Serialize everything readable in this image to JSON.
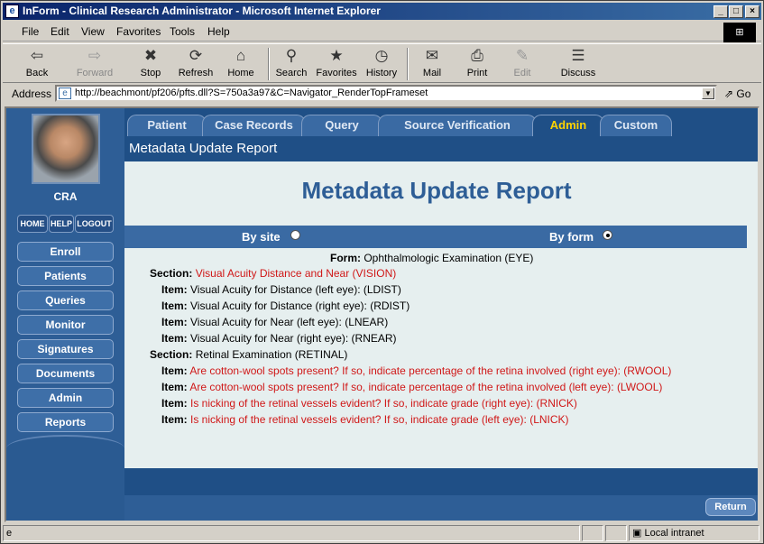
{
  "window": {
    "title": "InForm - Clinical Research Administrator - Microsoft Internet Explorer"
  },
  "menu": [
    "File",
    "Edit",
    "View",
    "Favorites",
    "Tools",
    "Help"
  ],
  "toolbar": [
    {
      "label": "Back",
      "icon": "back-arrow-icon",
      "glyph": "⇦"
    },
    {
      "label": "Forward",
      "icon": "forward-arrow-icon",
      "glyph": "⇨"
    },
    {
      "label": "Stop",
      "icon": "stop-icon",
      "glyph": "✖"
    },
    {
      "label": "Refresh",
      "icon": "refresh-icon",
      "glyph": "⟳"
    },
    {
      "label": "Home",
      "icon": "home-icon",
      "glyph": "⌂"
    },
    {
      "label": "Search",
      "icon": "search-icon",
      "glyph": "⚲"
    },
    {
      "label": "Favorites",
      "icon": "favorites-icon",
      "glyph": "★"
    },
    {
      "label": "History",
      "icon": "history-icon",
      "glyph": "◷"
    },
    {
      "label": "Mail",
      "icon": "mail-icon",
      "glyph": "✉"
    },
    {
      "label": "Print",
      "icon": "print-icon",
      "glyph": "⎙"
    },
    {
      "label": "Edit",
      "icon": "edit-icon",
      "glyph": "✎"
    },
    {
      "label": "Discuss",
      "icon": "discuss-icon",
      "glyph": "☰"
    }
  ],
  "address": {
    "label": "Address",
    "url": "http://beachmont/pf206/pfts.dll?S=750a3a97&C=Navigator_RenderTopFrameset",
    "go": "Go"
  },
  "sidebar": {
    "role": "CRA",
    "mini": [
      "HOME",
      "HELP",
      "LOGOUT"
    ],
    "nav": [
      "Enroll",
      "Patients",
      "Queries",
      "Monitor",
      "Signatures",
      "Documents",
      "Admin",
      "Reports"
    ]
  },
  "tabs": [
    "Patient",
    "Case Records",
    "Query",
    "Source Verification",
    "Admin",
    "Custom"
  ],
  "subheader": "Metadata Update Report",
  "report": {
    "title": "Metadata Update Report",
    "by_site": "By site",
    "by_form": "By form",
    "form_label": "Form:",
    "form_value": "Ophthalmologic Examination (EYE)",
    "section_label": "Section:",
    "item_label": "Item:",
    "sections": [
      {
        "name": "Visual Acuity Distance and Near (VISION)",
        "items": [
          "Visual Acuity for Distance (left eye): (LDIST)",
          "Visual Acuity for Distance (right eye): (RDIST)",
          "Visual Acuity for Near (left eye): (LNEAR)",
          "Visual Acuity for Near (right eye): (RNEAR)"
        ]
      },
      {
        "name": "Retinal Examination (RETINAL)",
        "items": [
          "Are cotton-wool spots present? If so, indicate percentage of the retina involved (right eye): (RWOOL)",
          "Are cotton-wool spots present? If so, indicate percentage of the retina involved (left eye): (LWOOL)",
          "Is nicking of the retinal vessels evident? If so, indicate grade (right eye): (RNICK)",
          "Is nicking of the retinal vessels evident? If so, indicate grade (left eye): (LNICK)"
        ]
      }
    ]
  },
  "return_label": "Return",
  "status": {
    "zone": "Local intranet"
  }
}
